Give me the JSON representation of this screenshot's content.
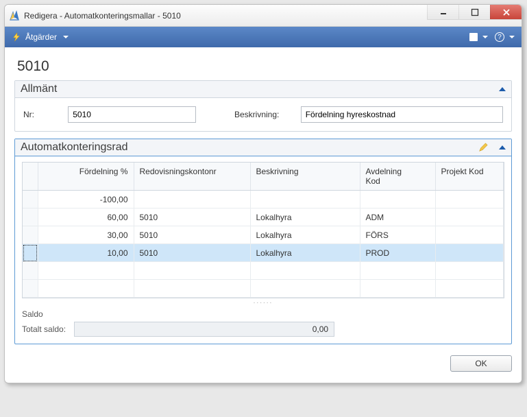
{
  "window": {
    "title": "Redigera - Automatkonteringsmallar - 5010"
  },
  "menu": {
    "actions": "Åtgärder"
  },
  "page": {
    "title": "5010"
  },
  "panel_general": {
    "title": "Allmänt",
    "nr_label": "Nr:",
    "nr_value": "5010",
    "descr_label": "Beskrivning:",
    "descr_value": "Fördelning hyreskostnad"
  },
  "panel_lines": {
    "title": "Automatkonteringsrad",
    "columns": {
      "fordelning": "Fördelning %",
      "redovis": "Redovisningskontonr",
      "beskrivning": "Beskrivning",
      "avdelning1": "Avdelning",
      "avdelning2": "Kod",
      "projekt": "Projekt Kod"
    },
    "rows": [
      {
        "fordelning": "-100,00",
        "redovis": "",
        "beskrivning": "",
        "avdelning": "",
        "projekt": ""
      },
      {
        "fordelning": "60,00",
        "redovis": "5010",
        "beskrivning": "Lokalhyra",
        "avdelning": "ADM",
        "projekt": ""
      },
      {
        "fordelning": "30,00",
        "redovis": "5010",
        "beskrivning": "Lokalhyra",
        "avdelning": "FÖRS",
        "projekt": ""
      },
      {
        "fordelning": "10,00",
        "redovis": "5010",
        "beskrivning": "Lokalhyra",
        "avdelning": "PROD",
        "projekt": ""
      }
    ],
    "saldo_label": "Saldo",
    "total_label": "Totalt saldo:",
    "total_value": "0,00"
  },
  "buttons": {
    "ok": "OK"
  }
}
